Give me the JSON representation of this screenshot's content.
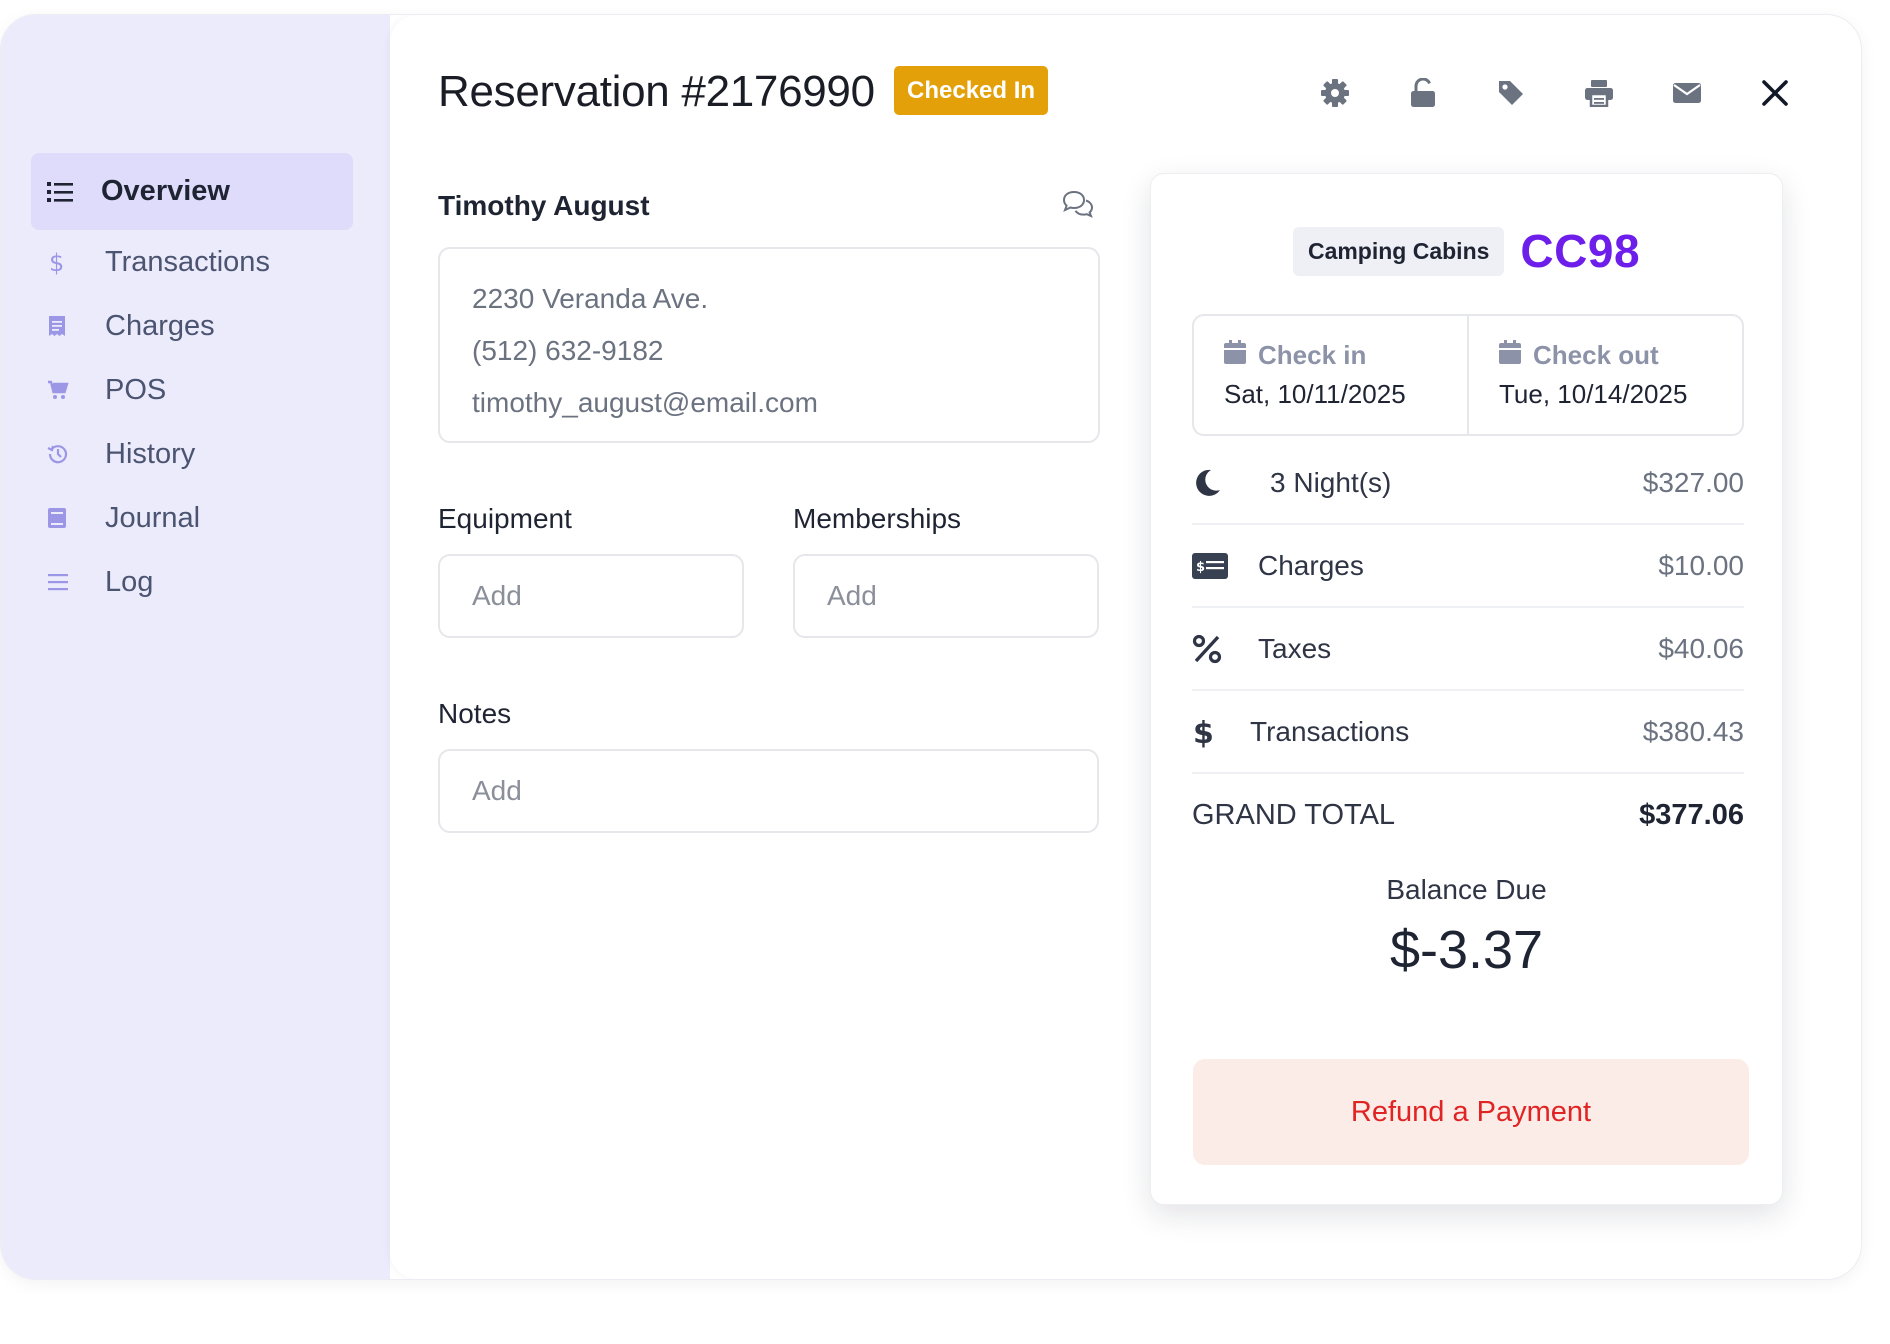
{
  "header": {
    "title": "Reservation #2176990",
    "status_badge": "Checked In"
  },
  "sidebar": {
    "items": [
      {
        "label": "Overview",
        "icon": "list-icon"
      },
      {
        "label": "Transactions",
        "icon": "dollar-icon"
      },
      {
        "label": "Charges",
        "icon": "receipt-icon"
      },
      {
        "label": "POS",
        "icon": "cart-icon"
      },
      {
        "label": "History",
        "icon": "history-icon"
      },
      {
        "label": "Journal",
        "icon": "book-icon"
      },
      {
        "label": "Log",
        "icon": "lines-icon"
      }
    ]
  },
  "guest": {
    "name": "Timothy August",
    "address": "2230 Veranda Ave.",
    "phone": "(512) 632-9182",
    "email": "timothy_august@email.com"
  },
  "equipment": {
    "label": "Equipment",
    "placeholder": "Add"
  },
  "memberships": {
    "label": "Memberships",
    "placeholder": "Add"
  },
  "notes": {
    "label": "Notes",
    "placeholder": "Add"
  },
  "summary": {
    "site_category": "Camping Cabins",
    "site_code": "CC98",
    "check_in": {
      "label": "Check in",
      "date": "Sat, 10/11/2025"
    },
    "check_out": {
      "label": "Check out",
      "date": "Tue, 10/14/2025"
    },
    "lines": [
      {
        "label": "3 Night(s)",
        "value": "$327.00",
        "icon": "moon-icon"
      },
      {
        "label": "Charges",
        "value": "$10.00",
        "icon": "bill-icon"
      },
      {
        "label": "Taxes",
        "value": "$40.06",
        "icon": "percent-icon"
      },
      {
        "label": "Transactions",
        "value": "$380.43",
        "icon": "dollar-icon"
      }
    ],
    "grand_total_label": "GRAND TOTAL",
    "grand_total_value": "$377.06",
    "balance_label": "Balance Due",
    "balance_value": "$-3.37",
    "refund_button": "Refund a Payment"
  },
  "colors": {
    "sidebar_bg": "#ecebfc",
    "active_nav_bg": "#dedcfa",
    "badge": "#e3a008",
    "site_code": "#6d1eea",
    "refund_bg": "#fcece7",
    "refund_text": "#e02424"
  }
}
